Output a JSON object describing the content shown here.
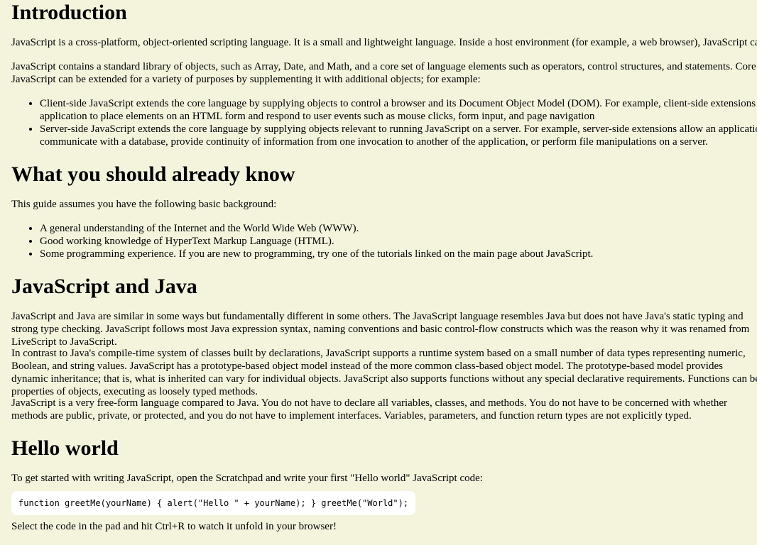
{
  "sections": {
    "intro": {
      "heading": "Introduction",
      "p1": "JavaScript is a cross-platform, object-oriented scripting language. It is a small and lightweight language. Inside a host environment (for example, a web browser), JavaScript can be connected to the objects of its environment to provide programmatic control over them.",
      "p2": "JavaScript contains a standard library of objects, such as Array, Date, and Math, and a core set of language elements such as operators, control structures, and statements. Core JavaScript can be extended for a variety of purposes by supplementing it with additional objects; for example:",
      "items": [
        "Client-side JavaScript extends the core language by supplying objects to control a browser and its Document Object Model (DOM). For example, client-side extensions allow an application to place elements on an HTML form and respond to user events such as mouse clicks, form input, and page navigation",
        "Server-side JavaScript extends the core language by supplying objects relevant to running JavaScript on a server. For example, server-side extensions allow an application to communicate with a database, provide continuity of information from one invocation to another of the application, or perform file manipulations on a server."
      ]
    },
    "know": {
      "heading": "What you should already know",
      "p1": "This guide assumes you have the following basic background:",
      "items": [
        "A general understanding of the Internet and the World Wide Web (WWW).",
        "Good working knowledge of HyperText Markup Language (HTML).",
        "Some programming experience. If you are new to programming, try one of the tutorials linked on the main page about JavaScript."
      ]
    },
    "java": {
      "heading": "JavaScript and Java",
      "p1": "JavaScript and Java are similar in some ways but fundamentally different in some others. The JavaScript language resembles Java but does not have Java's static typing and strong type checking. JavaScript follows most Java expression syntax, naming conventions and basic control-flow constructs which was the reason why it was renamed from LiveScript to JavaScript.",
      "p2": "In contrast to Java's compile-time system of classes built by declarations, JavaScript supports a runtime system based on a small number of data types representing numeric, Boolean, and string values. JavaScript has a prototype-based object model instead of the more common class-based object model. The prototype-based model provides dynamic inheritance; that is, what is inherited can vary for individual objects. JavaScript also supports functions without any special declarative requirements. Functions can be properties of objects, executing as loosely typed methods.",
      "p3": "JavaScript is a very free-form language compared to Java. You do not have to declare all variables, classes, and methods. You do not have to be concerned with whether methods are public, private, or protected, and you do not have to implement interfaces. Variables, parameters, and function return types are not explicitly typed."
    },
    "hello": {
      "heading": "Hello world",
      "p1": "To get started with writing JavaScript, open the Scratchpad and write your first \"Hello world\" JavaScript code:",
      "code": "function greetMe(yourName) { alert(\"Hello \" + yourName); } greetMe(\"World\");",
      "p2": "Select the code in the pad and hit Ctrl+R to watch it unfold in your browser!"
    }
  }
}
